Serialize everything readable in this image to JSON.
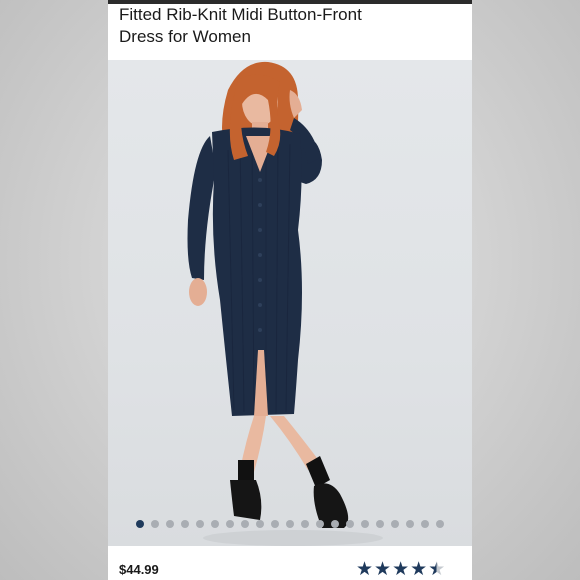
{
  "product": {
    "title": "Fitted Rib-Knit Midi Button-Front\nDress for Women",
    "price": "$44.99",
    "rating": 4.5,
    "rating_max": 5
  },
  "gallery": {
    "dot_count": 21,
    "active_index": 0
  },
  "colors": {
    "accent": "#1f3a5c",
    "dress": "#1e2d45",
    "hair": "#c4632f",
    "background_photo": "#e0e3e6"
  },
  "icons": {
    "star_full": "★",
    "star_half": "★"
  }
}
